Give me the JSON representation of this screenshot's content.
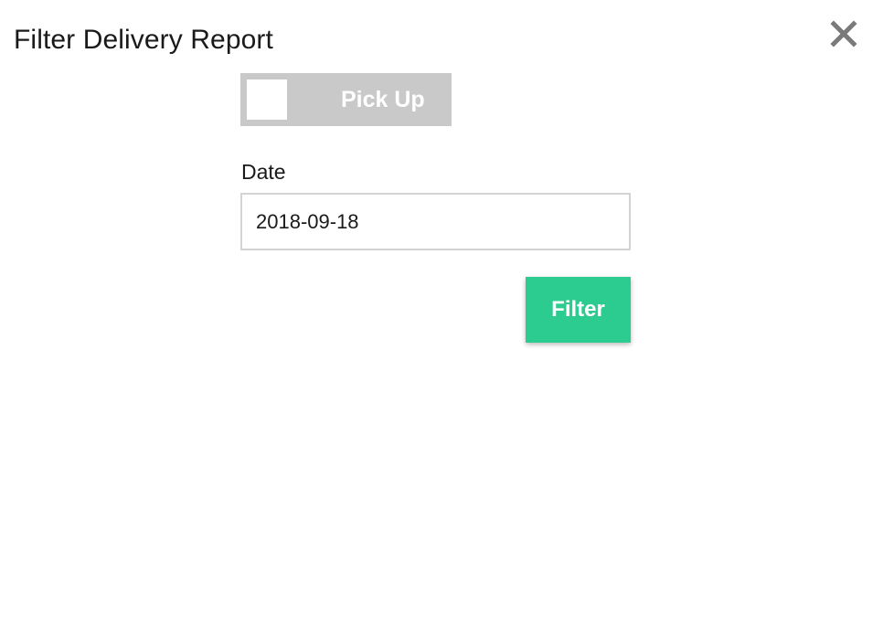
{
  "dialog": {
    "title": "Filter Delivery Report",
    "close_icon": "close-icon"
  },
  "toggle": {
    "label": "Pick Up",
    "state": "off",
    "track_color": "#c9c9c9"
  },
  "date_field": {
    "label": "Date",
    "value": "2018-09-18"
  },
  "filter_button": {
    "label": "Filter",
    "color": "#2ccb8f"
  }
}
